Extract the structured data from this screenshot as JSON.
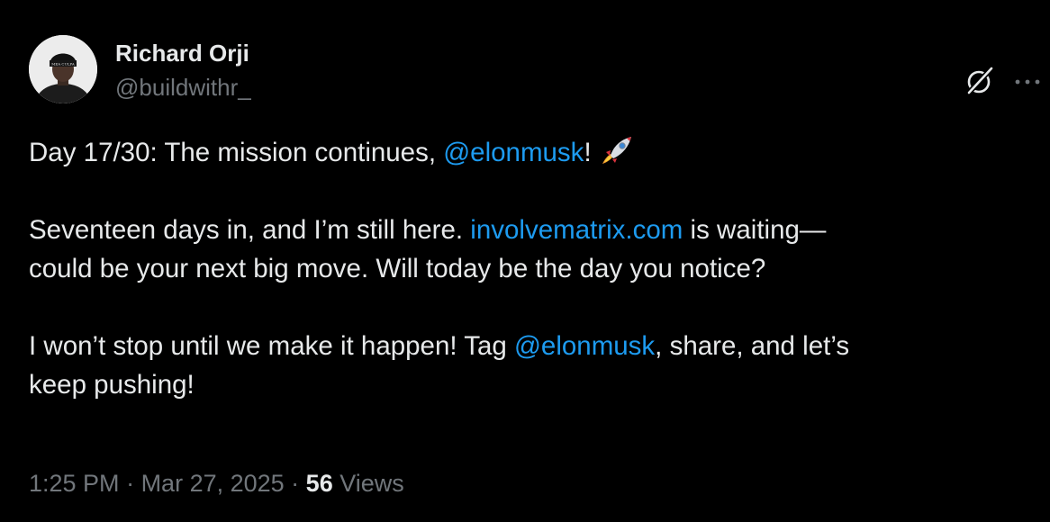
{
  "author": {
    "display_name": "Richard Orji",
    "handle": "@buildwithr_",
    "avatar_icon": "avatar-photo",
    "hat_text": "MEA CULPA"
  },
  "actions": {
    "grok_icon": "grok-icon",
    "more_icon": "more-options-icon"
  },
  "tweet": {
    "p1": {
      "pre": "Day 17/30: The mission continues, ",
      "mention": "@elonmusk",
      "post": "!",
      "emoji": "rocket-emoji"
    },
    "p2": {
      "pre": "Seventeen days in, and I’m still here. ",
      "link": "involvematrix.com",
      "post": " is waiting—",
      "line2": "could be your next big move. Will today be the day you notice?"
    },
    "p3": {
      "pre": "I won’t stop until we make it happen! Tag ",
      "mention": "@elonmusk",
      "post": ", share, and let’s",
      "line2": "keep pushing!"
    }
  },
  "meta": {
    "time": "1:25 PM",
    "separator": " · ",
    "date": "Mar 27, 2025",
    "views_count": "56",
    "views_label": "Views"
  },
  "colors": {
    "background": "#000000",
    "text": "#e7e9ea",
    "secondary": "#71767b",
    "link": "#1d9bf0"
  }
}
